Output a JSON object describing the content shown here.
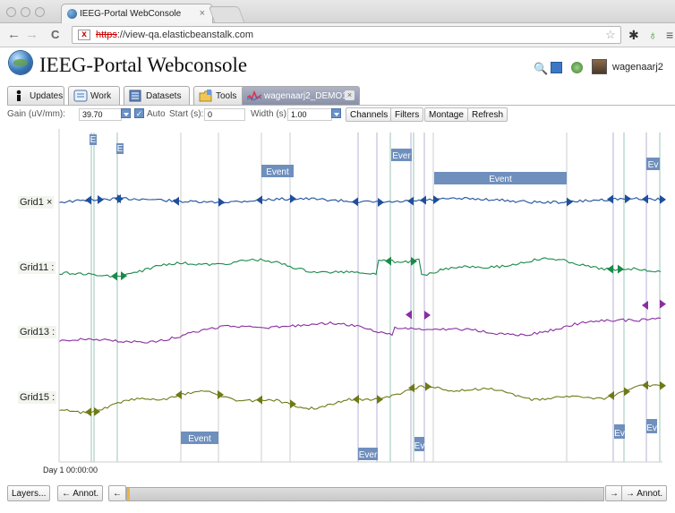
{
  "browser": {
    "tab_title": "IEEG-Portal WebConsole",
    "tab_close": "×",
    "url_scheme": "https",
    "url_rest": "://view-qa.elasticbeanstalk.com",
    "back": "←",
    "forward": "→",
    "reload": "C"
  },
  "app": {
    "title": "IEEG-Portal Webconsole",
    "username": "wagenaarj2"
  },
  "tabs": [
    {
      "label": "Updates",
      "icon": "person-icon"
    },
    {
      "label": "Work",
      "icon": "document-icon"
    },
    {
      "label": "Datasets",
      "icon": "datasets-icon"
    },
    {
      "label": "Tools",
      "icon": "folder-tools-icon"
    },
    {
      "label": "wagenaarj2_DEMO10",
      "icon": "eeg-wave-icon",
      "active": true,
      "close": "×"
    }
  ],
  "toolbar": {
    "gain_label": "Gain (uV/mm):",
    "gain_value": "39.70",
    "auto_label": "Auto",
    "auto_checked": true,
    "start_label": "Start (s):",
    "start_value": "0",
    "width_label": "Width (s):",
    "width_value": "1.00",
    "buttons": [
      "Channels",
      "Filters",
      "Montage",
      "Refresh"
    ]
  },
  "channels": [
    {
      "label": "Grid1",
      "suffix": "×",
      "color": "#1f4f9c"
    },
    {
      "label": "Grid11",
      "suffix": ":",
      "color": "#1a8a4a"
    },
    {
      "label": "Grid13",
      "suffix": ":",
      "color": "#8a2ea0"
    },
    {
      "label": "Grid15",
      "suffix": ":",
      "color": "#6f7a16"
    }
  ],
  "events": {
    "label_full": "Event",
    "label_short": "Ever",
    "label_tiny": "Ev",
    "label_e": "E"
  },
  "time_label": "Day 1 00:00:00",
  "bottom_nav": {
    "layers": "Layers...",
    "prev_annot": "← Annot.",
    "prev": "←",
    "next": "→",
    "next_annot": "→ Annot.",
    "scroll_position": 0.0
  },
  "colors": {
    "event_fill": "#6f8fbd",
    "accent": "#4b72a8"
  }
}
